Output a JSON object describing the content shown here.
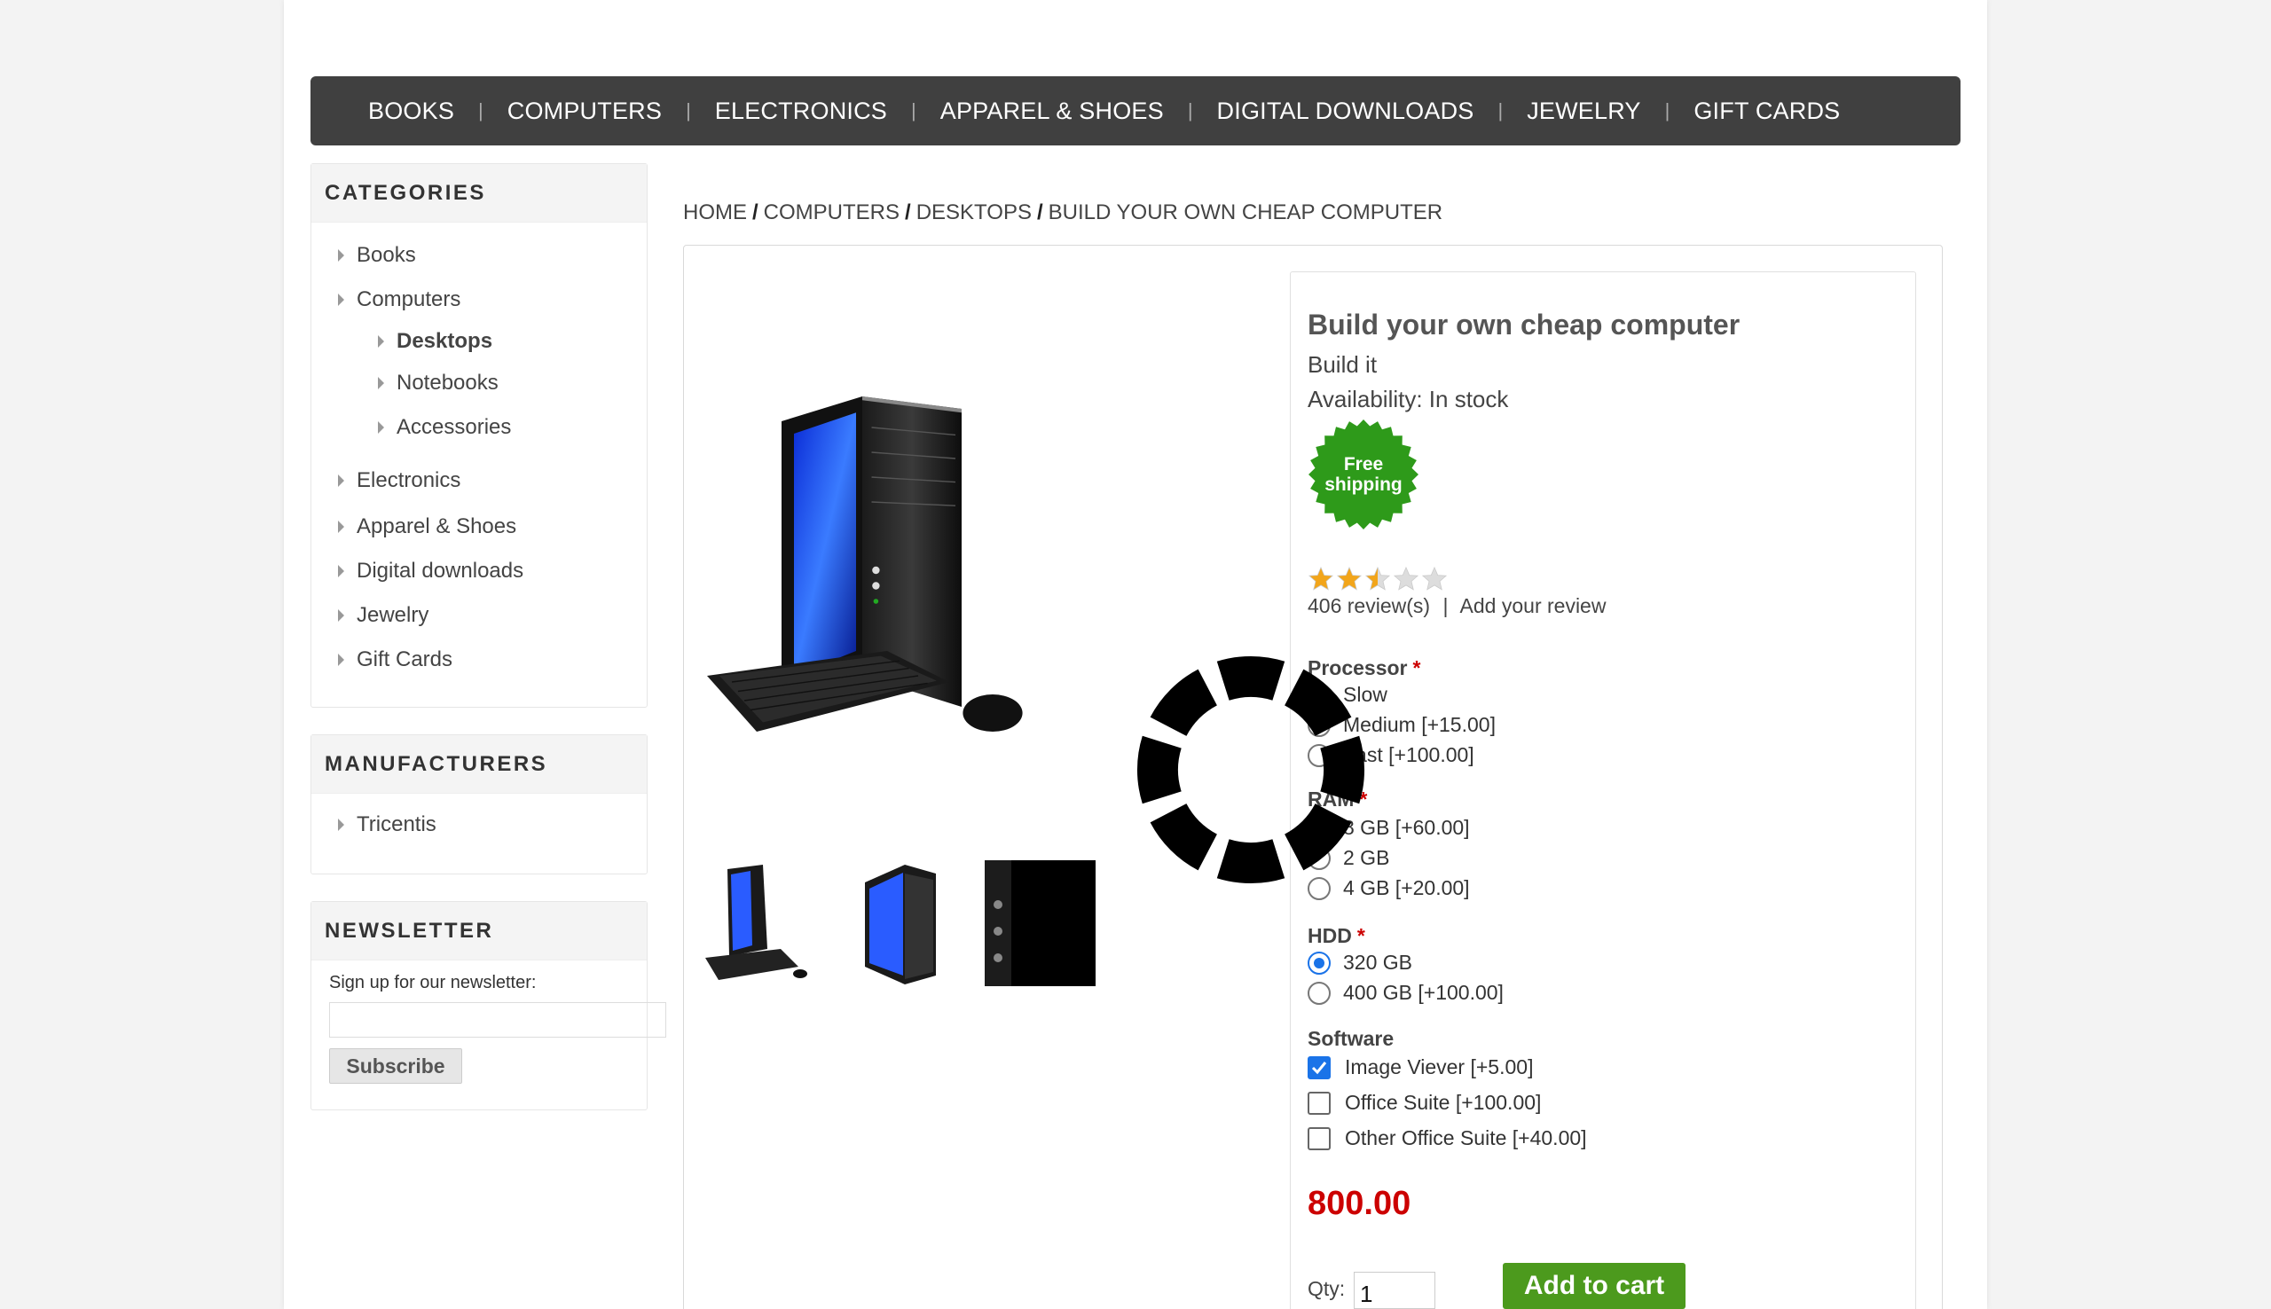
{
  "topnav": {
    "items": [
      "BOOKS",
      "COMPUTERS",
      "ELECTRONICS",
      "APPAREL & SHOES",
      "DIGITAL DOWNLOADS",
      "JEWELRY",
      "GIFT CARDS"
    ]
  },
  "categories": {
    "title": "CATEGORIES",
    "items": {
      "books": "Books",
      "computers": "Computers",
      "desktops": "Desktops",
      "notebooks": "Notebooks",
      "accessories": "Accessories",
      "electronics": "Electronics",
      "apparel": "Apparel & Shoes",
      "digital": "Digital downloads",
      "jewelry": "Jewelry",
      "giftcards": "Gift Cards"
    }
  },
  "manufacturers": {
    "title": "MANUFACTURERS",
    "items": [
      "Tricentis"
    ]
  },
  "newsletter": {
    "title": "NEWSLETTER",
    "label": "Sign up for our newsletter:",
    "input_value": "",
    "button": "Subscribe"
  },
  "breadcrumb": [
    "HOME",
    "COMPUTERS",
    "DESKTOPS",
    "BUILD YOUR OWN CHEAP COMPUTER"
  ],
  "product": {
    "title": "Build your own cheap computer",
    "short": "Build it",
    "availability": "Availability: In stock",
    "badge_line1": "Free",
    "badge_line2": "shipping",
    "rating": 2.5,
    "rating_max": 5,
    "reviews": "406 review(s)",
    "review_sep": "|",
    "add_review": "Add your review",
    "price": "800.00",
    "qty_label": "Qty:",
    "qty_value": "1",
    "add_to_cart": "Add to cart"
  },
  "attributes": {
    "processor": {
      "label": "Processor",
      "req": "*",
      "options": [
        "Slow",
        "Medium [+15.00]",
        "Fast [+100.00]"
      ],
      "selected": 0
    },
    "ram": {
      "label": "RAM",
      "req": "*",
      "options": [
        "8 GB [+60.00]",
        "2 GB",
        "4 GB [+20.00]"
      ],
      "selected": 0
    },
    "hdd": {
      "label": "HDD",
      "req": "*",
      "options": [
        "320 GB",
        "400 GB [+100.00]"
      ],
      "selected": 0
    },
    "software": {
      "label": "Software",
      "options": [
        "Image Viever [+5.00]",
        "Office Suite [+100.00]",
        "Other Office Suite [+40.00]"
      ],
      "checked": [
        true,
        false,
        false
      ]
    }
  },
  "colors": {
    "nav_bg": "#404040",
    "price": "#cc0000",
    "cart_btn": "#4c9a1d",
    "badge": "#2e9a1a",
    "radio_on": "#1a73e8",
    "star": "#f2a51a"
  }
}
